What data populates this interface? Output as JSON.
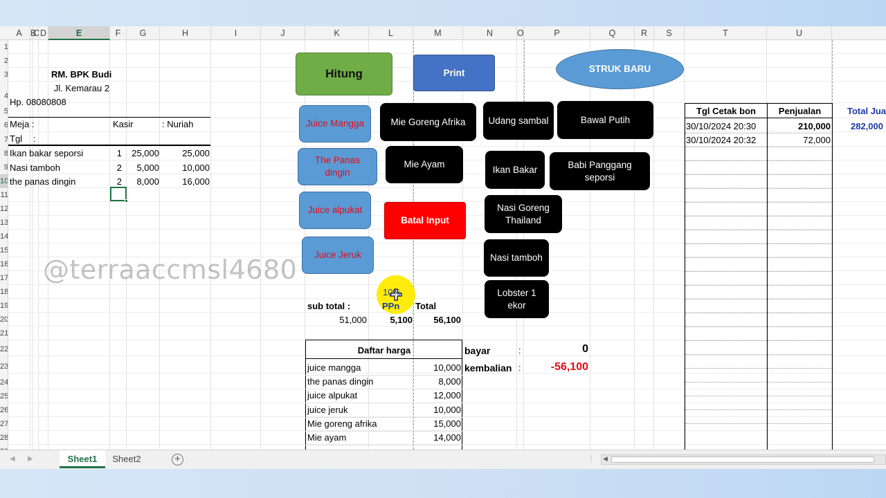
{
  "columns": [
    {
      "id": "A",
      "sel": false
    },
    {
      "id": "B",
      "sel": false
    },
    {
      "id": "C",
      "sel": false
    },
    {
      "id": "D",
      "sel": false
    },
    {
      "id": "E",
      "sel": true
    },
    {
      "id": "F",
      "sel": false
    },
    {
      "id": "G",
      "sel": false
    },
    {
      "id": "H",
      "sel": false
    },
    {
      "id": "I",
      "sel": false
    },
    {
      "id": "J",
      "sel": false
    },
    {
      "id": "K",
      "sel": false
    },
    {
      "id": "L",
      "sel": false
    },
    {
      "id": "M",
      "sel": false
    },
    {
      "id": "N",
      "sel": false
    },
    {
      "id": "O",
      "sel": false
    },
    {
      "id": "P",
      "sel": false
    },
    {
      "id": "Q",
      "sel": false
    },
    {
      "id": "R",
      "sel": false
    },
    {
      "id": "S",
      "sel": false
    },
    {
      "id": "T",
      "sel": false
    },
    {
      "id": "U",
      "sel": false
    }
  ],
  "rows": [
    "1",
    "2",
    "3",
    "4",
    "5",
    "6",
    "7",
    "8",
    "9",
    "10",
    "11",
    "12",
    "13",
    "14",
    "15",
    "16",
    "17",
    "18",
    "19",
    "20",
    "21",
    "22",
    "23",
    "24",
    "25",
    "26",
    "27",
    "28",
    "29"
  ],
  "selected_row": "10",
  "receipt": {
    "store_name": "RM. BPK Budi",
    "address": "Jl. Kemarau 2",
    "phone": "Hp. 08080808",
    "meja_label": "Meja :",
    "kasir_label": "Kasir",
    "kasir_value": ": Nuriah",
    "tgl_label": "Tgl",
    "tgl_colon": ":",
    "items": [
      {
        "name": "Ikan bakar seporsi",
        "qty": "1",
        "price": "25,000",
        "total": "25,000"
      },
      {
        "name": "Nasi tamboh",
        "qty": "2",
        "price": "5,000",
        "total": "10,000"
      },
      {
        "name": "the panas dingin",
        "qty": "2",
        "price": "8,000",
        "total": "16,000"
      }
    ]
  },
  "buttons": {
    "hitung": "Hitung",
    "print": "Print",
    "struk_baru": "STRUK BARU",
    "batal_input": "Batal Input",
    "juice_mangga": "Juice Mangga",
    "the_panas_dingin": "The Panas dingin",
    "juice_alpukat": "Juice alpukat",
    "juice_jeruk": "Juice Jeruk",
    "mie_goreng_afrika": "Mie Goreng Afrika",
    "mie_ayam": "Mie Ayam",
    "udang_sambal": "Udang sambal",
    "bawal_putih": "Bawal Putih",
    "ikan_bakar": "Ikan Bakar",
    "babi_panggang": "Babi Panggang seporsi",
    "nasi_goreng_thailand": "Nasi Goreng Thailand",
    "nasi_tamboh": "Nasi tamboh",
    "lobster": "Lobster 1 ekor"
  },
  "summary": {
    "ppn_rate": "10%",
    "subtotal_label": "sub total :",
    "ppn_label": "PPn",
    "total_label": "Total",
    "subtotal": "51,000",
    "ppn": "5,100",
    "total": "56,100"
  },
  "payment": {
    "bayar_label": "bayar",
    "bayar_colon": ":",
    "bayar_value": "0",
    "kembalian_label": "kembalian",
    "kembalian_colon": ":",
    "kembalian_value": "-56,100"
  },
  "price_list": {
    "header": "Daftar harga",
    "items": [
      {
        "name": "juice mangga",
        "price": "10,000"
      },
      {
        "name": "the panas dingin",
        "price": "8,000"
      },
      {
        "name": "juice alpukat",
        "price": "12,000"
      },
      {
        "name": "juice jeruk",
        "price": "10,000"
      },
      {
        "name": "Mie goreng afrika",
        "price": "15,000"
      },
      {
        "name": "Mie ayam",
        "price": "14,000"
      }
    ]
  },
  "sales": {
    "headers": [
      "Tgl Cetak bon",
      "Penjualan",
      "Total Jual"
    ],
    "rows": [
      {
        "date": "30/10/2024 20:30",
        "amount": "210,000"
      },
      {
        "date": "30/10/2024 20:32",
        "amount": "72,000"
      }
    ],
    "grand_total": "282,000"
  },
  "watermark": "@terraaccmsl4680",
  "tabs": [
    {
      "label": "Sheet1",
      "active": true
    },
    {
      "label": "Sheet2",
      "active": false
    }
  ],
  "add_sheet": "+",
  "colors": {
    "excel_green": "#217346",
    "button_black": "#000000",
    "button_light_blue": "#5b9bd5",
    "button_dark_blue": "#4472c4",
    "button_green": "#70ad47",
    "button_red": "#ff0000",
    "highlight_yellow": "#ffeb00"
  }
}
